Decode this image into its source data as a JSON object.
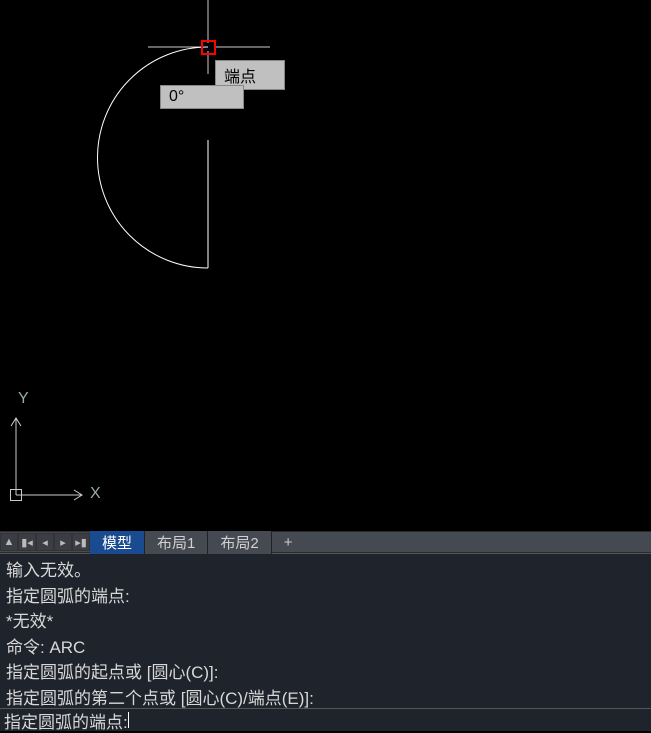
{
  "canvas": {
    "snap_tooltip": "端点",
    "angle_tooltip": "0°",
    "axis_x_label": "X",
    "axis_y_label": "Y"
  },
  "tabs": {
    "nav_first": "|◀",
    "nav_prev": "◀",
    "nav_next": "▶",
    "nav_last": "▶|",
    "model": "模型",
    "layout1": "布局1",
    "layout2": "布局2",
    "plus": "+"
  },
  "history": {
    "line1": "输入无效。",
    "line2": "指定圆弧的端点:",
    "line3": "*无效*",
    "line4": "命令:  ARC",
    "line5": "指定圆弧的起点或 [圆心(C)]:",
    "line6": "指定圆弧的第二个点或 [圆心(C)/端点(E)]:"
  },
  "commandline": {
    "prompt": "指定圆弧的端点:",
    "value": ""
  }
}
